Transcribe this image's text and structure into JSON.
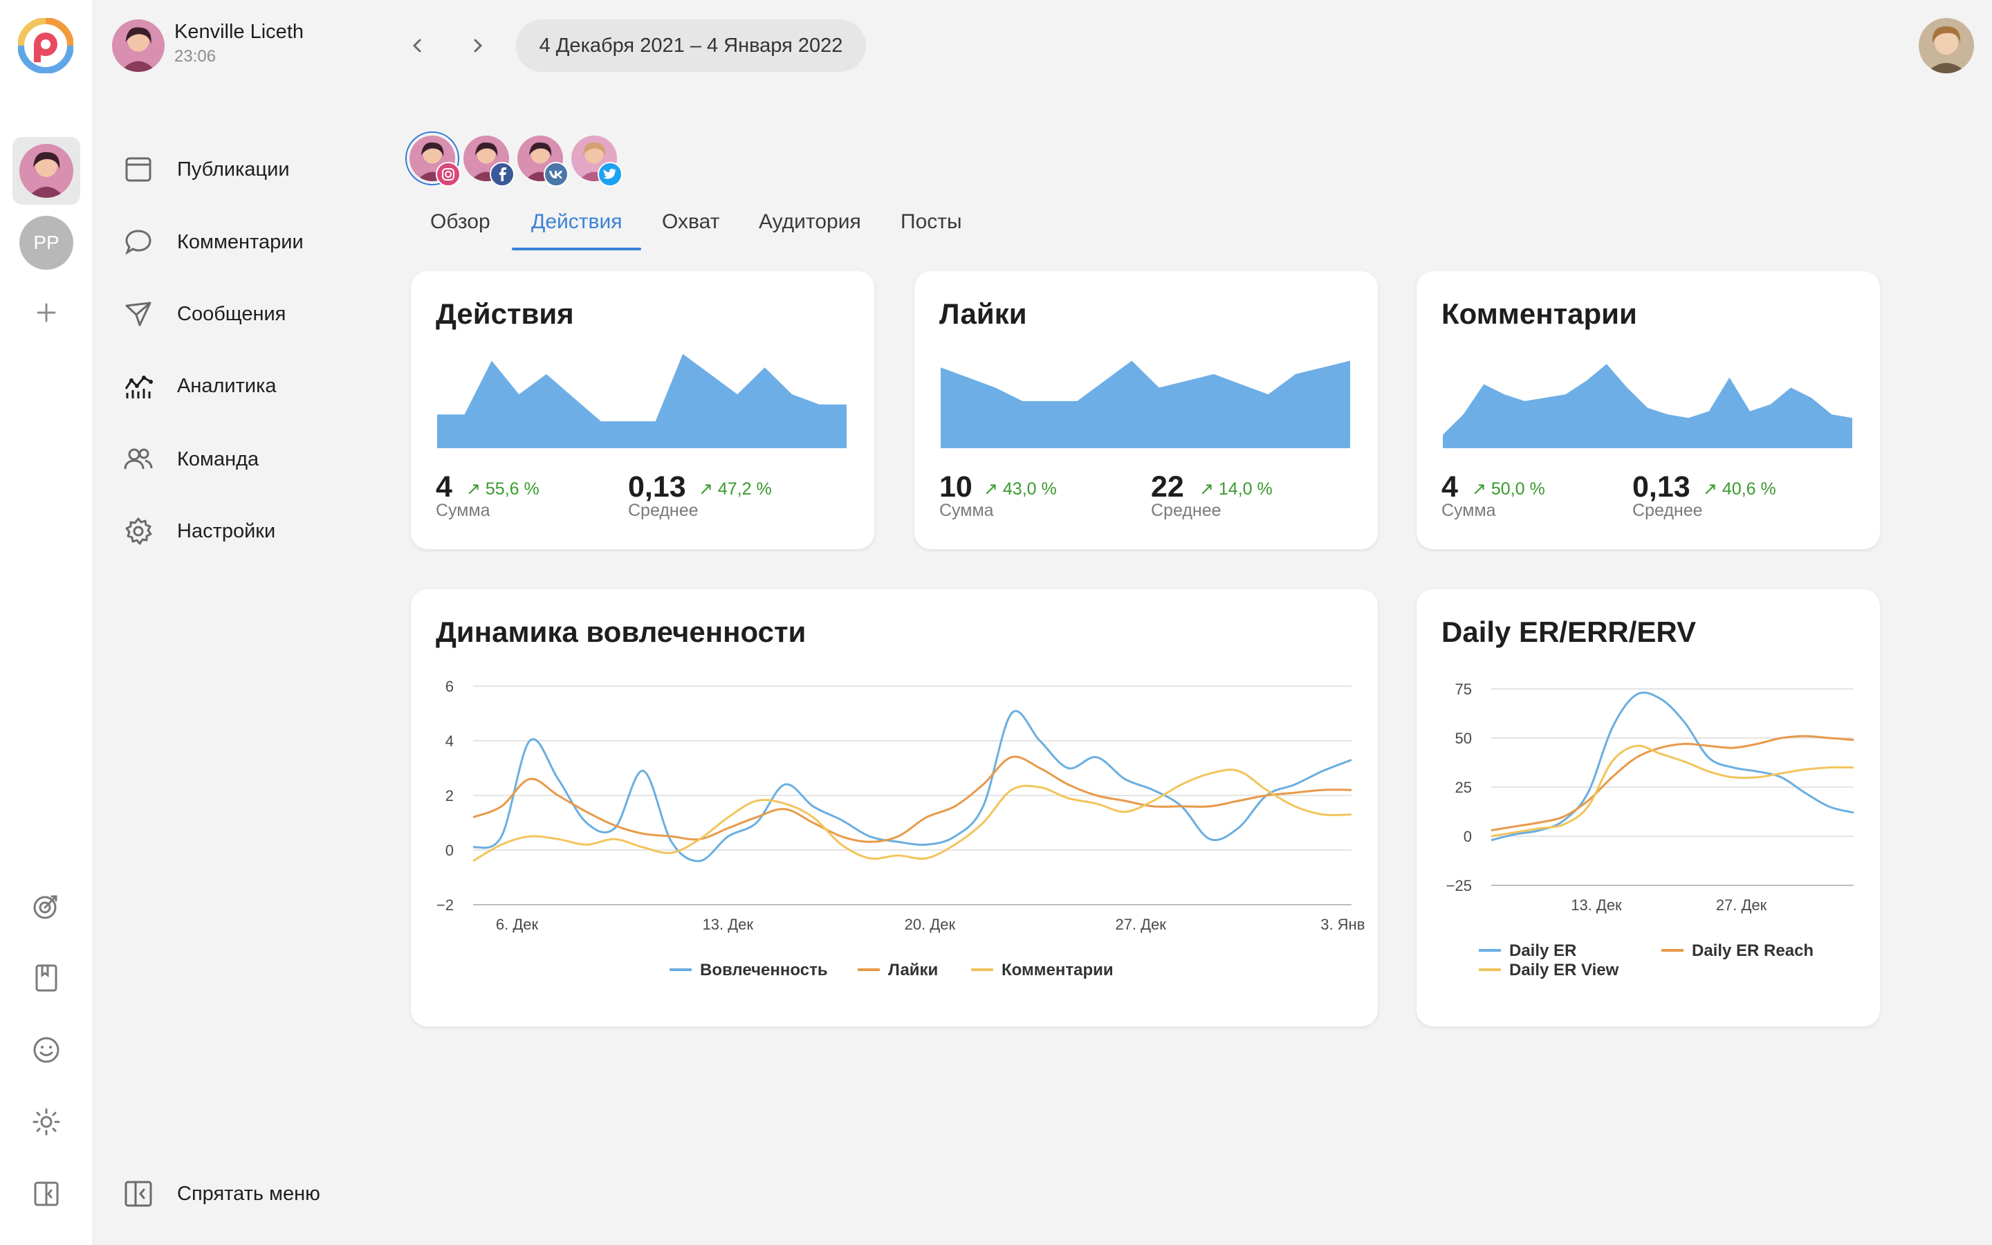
{
  "header": {
    "user_name": "Kenville Liceth",
    "time": "23:06",
    "date_range": "4 Декабря 2021 – 4 Января 2022"
  },
  "rail": {
    "pp_initials": "PP"
  },
  "menu": {
    "items": [
      {
        "label": "Публикации",
        "icon": "calendar-icon"
      },
      {
        "label": "Комментарии",
        "icon": "comment-icon"
      },
      {
        "label": "Сообщения",
        "icon": "send-icon"
      },
      {
        "label": "Аналитика",
        "icon": "analytics-icon"
      },
      {
        "label": "Команда",
        "icon": "team-icon"
      },
      {
        "label": "Настройки",
        "icon": "settings-icon"
      }
    ],
    "hide_label": "Спрятать меню"
  },
  "tabs": [
    "Обзор",
    "Действия",
    "Охват",
    "Аудитория",
    "Посты"
  ],
  "active_tab": "Действия",
  "cards": [
    {
      "title": "Действия",
      "sum": "4",
      "sum_change": "↗ 55,6 %",
      "sum_label": "Сумма",
      "avg": "0,13",
      "avg_change": "↗ 47,2 %",
      "avg_label": "Среднее",
      "spark": [
        1.0,
        1.0,
        2.6,
        1.6,
        2.2,
        1.5,
        0.8,
        0.8,
        0.8,
        2.8,
        2.2,
        1.6,
        2.4,
        1.6,
        1.3,
        1.3
      ]
    },
    {
      "title": "Лайки",
      "sum": "10",
      "sum_change": "↗ 43,0 %",
      "sum_label": "Сумма",
      "avg": "22",
      "avg_change": "↗ 14,0 %",
      "avg_label": "Среднее",
      "spark": [
        2.4,
        2.1,
        1.8,
        1.4,
        1.4,
        1.4,
        2.0,
        2.6,
        1.8,
        2.0,
        2.2,
        1.9,
        1.6,
        2.2,
        2.4,
        2.6
      ]
    },
    {
      "title": "Комментарии",
      "sum": "4",
      "sum_change": "↗ 50,0 %",
      "sum_label": "Сумма",
      "avg": "0,13",
      "avg_change": "↗ 40,6 %",
      "avg_label": "Среднее",
      "spark": [
        0.4,
        1.0,
        1.9,
        1.6,
        1.4,
        1.5,
        1.6,
        2.0,
        2.5,
        1.8,
        1.2,
        1.0,
        0.9,
        1.1,
        2.1,
        1.1,
        1.3,
        1.8,
        1.5,
        1.0,
        0.9
      ]
    }
  ],
  "engagement": {
    "title": "Динамика вовлеченности",
    "chart_data": {
      "type": "line",
      "x_ticks": [
        "6. Дек",
        "13. Дек",
        "20. Дек",
        "27. Дек",
        "3. Янв"
      ],
      "ylim": [
        -2,
        6
      ],
      "y_ticks": [
        6,
        4,
        2,
        0,
        -2
      ],
      "x": [
        "4. Дек",
        "5. Дек",
        "6. Дек",
        "7. Дек",
        "8. Дек",
        "9. Дек",
        "10. Дек",
        "11. Дек",
        "12. Дек",
        "13. Дек",
        "14. Дек",
        "15. Дек",
        "16. Дек",
        "17. Дек",
        "18. Дек",
        "19. Дек",
        "20. Дек",
        "21. Дек",
        "22. Дек",
        "23. Дек",
        "24. Дек",
        "25. Дек",
        "26. Дек",
        "27. Дек",
        "28. Дек",
        "29. Дек",
        "30. Дек",
        "31. Дек",
        "1. Янв",
        "2. Янв",
        "3. Янв",
        "4. Янв"
      ],
      "series": [
        {
          "name": "Вовлеченность",
          "color": "#6aaee0",
          "values": [
            0.1,
            0.5,
            4.0,
            2.6,
            1.0,
            0.8,
            2.9,
            0.3,
            -0.4,
            0.5,
            1.0,
            2.4,
            1.6,
            1.1,
            0.5,
            0.3,
            0.2,
            0.5,
            1.6,
            5.0,
            4.0,
            3.0,
            3.4,
            2.6,
            2.2,
            1.6,
            0.4,
            0.8,
            2.0,
            2.4,
            2.9,
            3.3
          ]
        },
        {
          "name": "Лайки",
          "color": "#e8994a",
          "values": [
            1.2,
            1.6,
            2.6,
            2.0,
            1.4,
            0.9,
            0.6,
            0.5,
            0.4,
            0.8,
            1.2,
            1.5,
            1.0,
            0.5,
            0.3,
            0.5,
            1.2,
            1.6,
            2.4,
            3.4,
            3.0,
            2.4,
            2.0,
            1.8,
            1.6,
            1.6,
            1.6,
            1.8,
            2.0,
            2.1,
            2.2,
            2.2
          ]
        },
        {
          "name": "Комментарии",
          "color": "#f2c45c",
          "values": [
            -0.4,
            0.2,
            0.5,
            0.4,
            0.2,
            0.4,
            0.1,
            -0.1,
            0.4,
            1.2,
            1.8,
            1.7,
            1.2,
            0.2,
            -0.3,
            -0.2,
            -0.3,
            0.2,
            1.0,
            2.2,
            2.3,
            1.9,
            1.7,
            1.4,
            1.8,
            2.4,
            2.8,
            2.9,
            2.2,
            1.6,
            1.3,
            1.3
          ]
        }
      ]
    }
  },
  "daily": {
    "title": "Daily ER/ERR/ERV",
    "chart_data": {
      "type": "line",
      "x_ticks": [
        "13. Дек",
        "27. Дек"
      ],
      "ylim": [
        -25,
        75
      ],
      "y_ticks": [
        75,
        50,
        25,
        0,
        -25
      ],
      "x": [
        "4. Дек",
        "6. Дек",
        "8. Дек",
        "10. Дек",
        "12. Дек",
        "14. Дек",
        "16. Дек",
        "18. Дек",
        "20. Дек",
        "22. Дек",
        "24. Дек",
        "26. Дек",
        "28. Дек",
        "30. Дек",
        "1. Янв",
        "3. Янв"
      ],
      "series": [
        {
          "name": "Daily ER",
          "color": "#6aaee0",
          "values": [
            -2,
            1,
            3,
            8,
            22,
            55,
            72,
            70,
            58,
            40,
            35,
            33,
            30,
            22,
            15,
            12
          ]
        },
        {
          "name": "Daily ER Reach",
          "color": "#e8994a",
          "values": [
            3,
            5,
            7,
            10,
            18,
            30,
            40,
            45,
            47,
            46,
            45,
            47,
            50,
            51,
            50,
            49
          ]
        },
        {
          "name": "Daily ER View",
          "color": "#f2c45c",
          "values": [
            0,
            2,
            4,
            6,
            15,
            38,
            46,
            42,
            38,
            33,
            30,
            30,
            32,
            34,
            35,
            35
          ]
        }
      ]
    }
  }
}
